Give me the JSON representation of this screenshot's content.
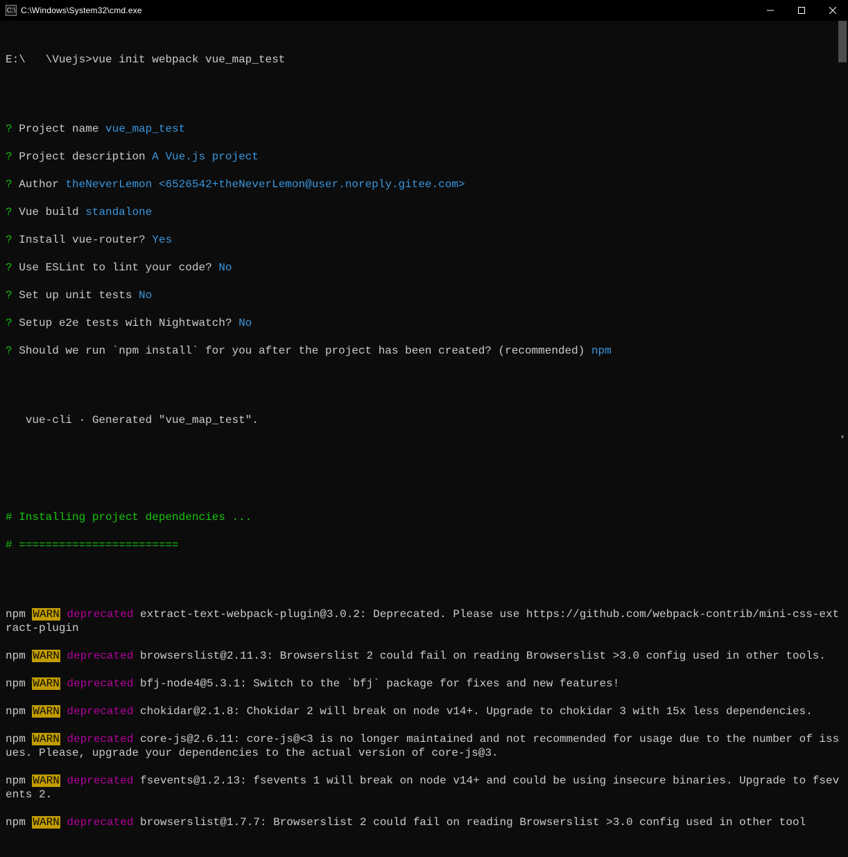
{
  "window": {
    "title": "C:\\Windows\\System32\\cmd.exe",
    "icon_label": "cmd-icon"
  },
  "prompt": {
    "path": "E:\\   \\Vuejs>",
    "command": "vue init webpack vue_map_test"
  },
  "prompts": [
    {
      "q": "?",
      "label": "Project name ",
      "answer": "vue_map_test"
    },
    {
      "q": "?",
      "label": "Project description ",
      "answer": "A Vue.js project"
    },
    {
      "q": "?",
      "label": "Author ",
      "answer": "theNeverLemon <6526542+theNeverLemon@user.noreply.gitee.com>"
    },
    {
      "q": "?",
      "label": "Vue build ",
      "answer": "standalone"
    },
    {
      "q": "?",
      "label": "Install vue-router? ",
      "answer": "Yes"
    },
    {
      "q": "?",
      "label": "Use ESLint to lint your code? ",
      "answer": "No"
    },
    {
      "q": "?",
      "label": "Set up unit tests ",
      "answer": "No"
    },
    {
      "q": "?",
      "label": "Setup e2e tests with Nightwatch? ",
      "answer": "No"
    },
    {
      "q": "?",
      "label": "Should we run `npm install` for you after the project has been created? (recommended) ",
      "answer": "npm"
    }
  ],
  "generated": {
    "prefix": "   vue-cli · Generated ",
    "name": "\"vue_map_test\"."
  },
  "section": {
    "hash1": "# ",
    "installing": "Installing project dependencies ...",
    "hash2": "# ========================"
  },
  "warns": [
    {
      "npm": "npm ",
      "warn": "WARN",
      "dep": " deprecated",
      "msg": " extract-text-webpack-plugin@3.0.2: Deprecated. Please use https://github.com/webpack-contrib/mini-css-extract-plugin"
    },
    {
      "npm": "npm ",
      "warn": "WARN",
      "dep": " deprecated",
      "msg": " browserslist@2.11.3: Browserslist 2 could fail on reading Browserslist >3.0 config used in other tools."
    },
    {
      "npm": "npm ",
      "warn": "WARN",
      "dep": " deprecated",
      "msg": " bfj-node4@5.3.1: Switch to the `bfj` package for fixes and new features!"
    },
    {
      "npm": "npm ",
      "warn": "WARN",
      "dep": " deprecated",
      "msg": " chokidar@2.1.8: Chokidar 2 will break on node v14+. Upgrade to chokidar 3 with 15x less dependencies."
    },
    {
      "npm": "npm ",
      "warn": "WARN",
      "dep": " deprecated",
      "msg": " core-js@2.6.11: core-js@<3 is no longer maintained and not recommended for usage due to the number of issues. Please, upgrade your dependencies to the actual version of core-js@3."
    },
    {
      "npm": "npm ",
      "warn": "WARN",
      "dep": " deprecated",
      "msg": " fsevents@1.2.13: fsevents 1 will break on node v14+ and could be using insecure binaries. Upgrade to fsevents 2."
    },
    {
      "npm": "npm ",
      "warn": "WARN",
      "dep": " deprecated",
      "msg": " browserslist@1.7.7: Browserslist 2 could fail on reading Browserslist >3.0 config used in other tool"
    }
  ]
}
